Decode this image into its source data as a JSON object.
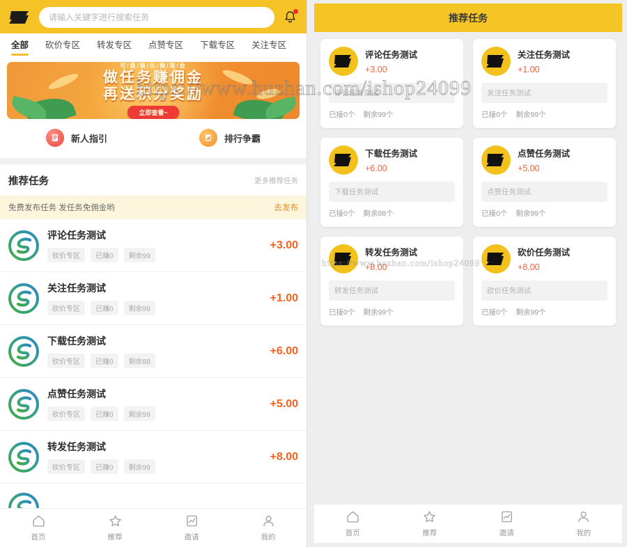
{
  "left": {
    "header": {
      "logo_icon": "s-logo-icon",
      "search_placeholder": "请输入关键字进行搜索任务",
      "search_value": "",
      "bell_icon": "bell-icon"
    },
    "tabs": [
      {
        "label": "全部",
        "active": true
      },
      {
        "label": "砍价专区",
        "active": false
      },
      {
        "label": "转发专区",
        "active": false
      },
      {
        "label": "点赞专区",
        "active": false
      },
      {
        "label": "下载专区",
        "active": false
      },
      {
        "label": "关注专区",
        "active": false
      }
    ],
    "banner": {
      "sub": "可/盘/换/化/换/现/金",
      "line1": "做任务赚佣金",
      "line2": "再送积分奖励",
      "button": "立即查看~"
    },
    "quick_links": [
      {
        "label": "新人指引",
        "icon": "guide-book-icon"
      },
      {
        "label": "排行争霸",
        "icon": "ranking-chart-icon"
      }
    ],
    "section": {
      "title": "推荐任务",
      "more": "更多推荐任务"
    },
    "promo": {
      "text": "免费发布任务 发任务免佣金哟",
      "action": "去发布"
    },
    "tasks": [
      {
        "title": "评论任务测试",
        "zone": "砍价专区",
        "earned": "已赚0",
        "remain": "剩余99",
        "price": "+3.00"
      },
      {
        "title": "关注任务测试",
        "zone": "砍价专区",
        "earned": "已赚0",
        "remain": "剩余99",
        "price": "+1.00"
      },
      {
        "title": "下载任务测试",
        "zone": "砍价专区",
        "earned": "已赚0",
        "remain": "剩余88",
        "price": "+6.00"
      },
      {
        "title": "点赞任务测试",
        "zone": "砍价专区",
        "earned": "已赚0",
        "remain": "剩余99",
        "price": "+5.00"
      },
      {
        "title": "转发任务测试",
        "zone": "砍价专区",
        "earned": "已赚0",
        "remain": "剩余99",
        "price": "+8.00"
      }
    ],
    "tabbar": [
      {
        "label": "首页",
        "icon": "home-icon"
      },
      {
        "label": "推荐",
        "icon": "star-icon"
      },
      {
        "label": "邀请",
        "icon": "invite-chart-icon"
      },
      {
        "label": "我的",
        "icon": "person-icon"
      }
    ]
  },
  "right": {
    "header_title": "推荐任务",
    "cards": [
      {
        "title": "评论任务测试",
        "price": "+3.00",
        "desc": "评论任务测试",
        "accepted": "已接0个",
        "remain": "剩余99个"
      },
      {
        "title": "关注任务测试",
        "price": "+1.00",
        "desc": "关注任务测试",
        "accepted": "已接0个",
        "remain": "剩余99个"
      },
      {
        "title": "下载任务测试",
        "price": "+6.00",
        "desc": "下载任务测试",
        "accepted": "已接0个",
        "remain": "剩余88个"
      },
      {
        "title": "点赞任务测试",
        "price": "+5.00",
        "desc": "点赞任务测试",
        "accepted": "已接0个",
        "remain": "剩余99个"
      },
      {
        "title": "转发任务测试",
        "price": "+8.00",
        "desc": "转发任务测试",
        "accepted": "已接0个",
        "remain": "剩余99个"
      },
      {
        "title": "砍价任务测试",
        "price": "+8.00",
        "desc": "砍价任务测试",
        "accepted": "已接0个",
        "remain": "剩余99个"
      }
    ],
    "tabbar": [
      {
        "label": "首页",
        "icon": "home-icon"
      },
      {
        "label": "推荐",
        "icon": "star-icon"
      },
      {
        "label": "邀请",
        "icon": "invite-chart-icon"
      },
      {
        "label": "我的",
        "icon": "person-icon"
      }
    ]
  },
  "watermark": {
    "line1": "https://www.huzhan.com/ishop24099"
  },
  "colors": {
    "brand_yellow": "#f5c325",
    "price_orange": "#f4621f",
    "card_price": "#f0633a",
    "promo_bg": "#fdf6dd",
    "promo_action": "#e98c1f",
    "page_bg": "#eeeeee"
  }
}
